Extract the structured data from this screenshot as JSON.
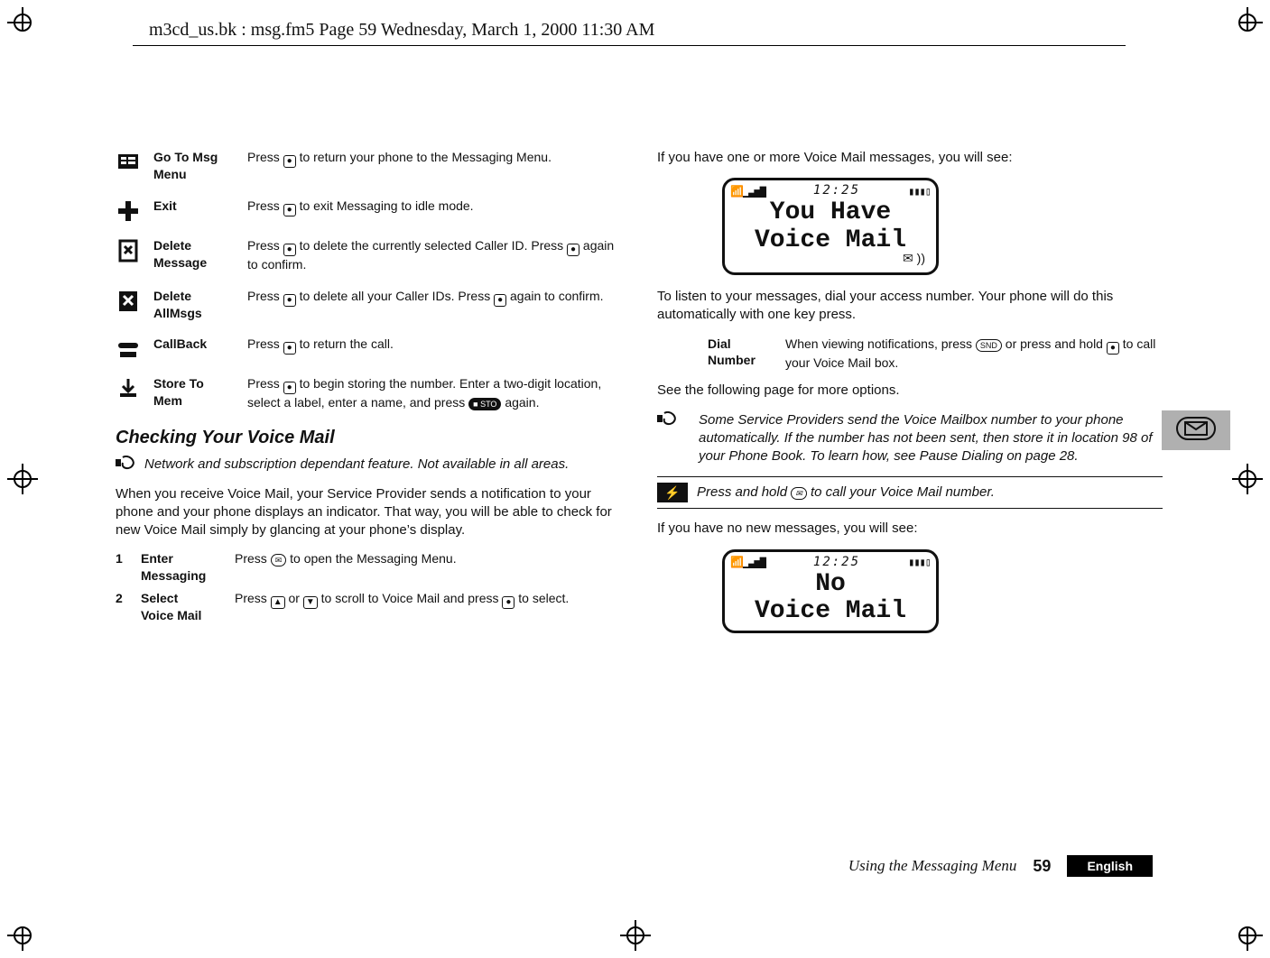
{
  "header": {
    "line": "m3cd_us.bk : msg.fm5  Page 59  Wednesday, March 1, 2000  11:30 AM"
  },
  "left": {
    "options": [
      {
        "icon": "go-to-msg-menu",
        "title_l1": "Go To Msg",
        "title_l2": "Menu",
        "desc": "Press AOK to return your phone to the Messaging Menu."
      },
      {
        "icon": "exit",
        "title_l1": "Exit",
        "title_l2": "",
        "desc": "Press AOK to exit Messaging to idle mode."
      },
      {
        "icon": "delete-message",
        "title_l1": "Delete",
        "title_l2": "Message",
        "desc": "Press AOK to delete the currently selected Caller ID. Press AOK again to confirm."
      },
      {
        "icon": "delete-allmsgs",
        "title_l1": "Delete",
        "title_l2": "AllMsgs",
        "desc": "Press AOK to delete all your Caller IDs. Press AOK again to confirm."
      },
      {
        "icon": "callback",
        "title_l1": "CallBack",
        "title_l2": "",
        "desc": "Press AOK to return the call."
      },
      {
        "icon": "store-to-mem",
        "title_l1": "Store To",
        "title_l2": "Mem",
        "desc": "Press AOK to begin storing the number. Enter a two-digit location, select a label, enter a name, and press ASTO again."
      }
    ],
    "section_title": "Checking Your Voice Mail",
    "note_network": "Network and subscription dependant feature. Not available in all areas.",
    "body": "When you receive Voice Mail, your Service Provider sends a notification to your phone and your phone displays an indicator. That way, you will be able to check for new Voice Mail simply by glancing at your phone’s display.",
    "steps": [
      {
        "num": "1",
        "title_l1": "Enter",
        "title_l2": "Messaging",
        "desc": "Press AMAIL to open the Messaging Menu."
      },
      {
        "num": "2",
        "title_l1": "Select",
        "title_l2": "Voice Mail",
        "desc": "Press AUP or ADOWN to scroll to Voice Mail and press AOK to select."
      }
    ]
  },
  "right": {
    "intro1": "If you have one or more Voice Mail messages, you will see:",
    "lcd1": {
      "clock": "12:25",
      "line1": "You Have",
      "line2": "Voice Mail",
      "show_mail_icon": true
    },
    "intro2": "To listen to your messages, dial your access number. Your phone will do this automatically with one key press.",
    "dial": {
      "title_l1": "Dial",
      "title_l2": "Number",
      "desc": "When viewing notifications, press ASND or press and hold AOK to call your Voice Mail box."
    },
    "see_more": "See the following page for more options.",
    "note_provider": "Some Service Providers send the Voice Mailbox number to your phone automatically. If the number has not been sent, then store it in location 98 of your Phone Book. To learn how, see Pause Dialing on page 28.",
    "tip": "Press and hold AMAIL to call your Voice Mail number.",
    "intro3": "If you have no new messages, you will see:",
    "lcd2": {
      "clock": "12:25",
      "line1": "No",
      "line2": "Voice Mail",
      "show_mail_icon": false
    }
  },
  "footer": {
    "title": "Using the Messaging Menu",
    "page": "59",
    "lang": "English"
  }
}
